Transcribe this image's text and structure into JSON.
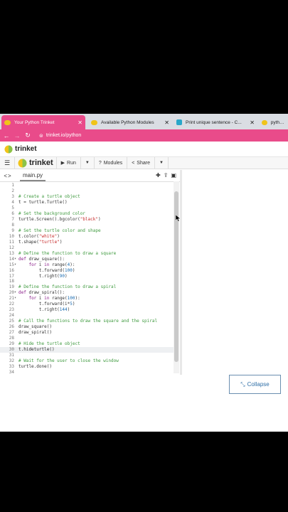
{
  "browser": {
    "tabs": [
      {
        "label": "Your Python Trinket",
        "color": "#f0c419",
        "active": true
      },
      {
        "label": "Available Python Modules",
        "color": "#f0c419",
        "active": false
      },
      {
        "label": "Print unique sentence - C...",
        "color": "#2aa7c9",
        "active": false
      },
      {
        "label": "python -",
        "color": "#f0c419",
        "active": false
      }
    ],
    "close_glyph": "✕",
    "url": "trinket.io/python"
  },
  "header": {
    "name": "trinket"
  },
  "toolbar": {
    "brand": "trinket",
    "run_label": "Run",
    "modules_label": "Modules",
    "share_label": "Share"
  },
  "editor": {
    "file_name": "main.py",
    "active_line": 30,
    "lines": [
      {
        "n": "1",
        "fold": "",
        "html": ""
      },
      {
        "n": "2",
        "fold": "",
        "html": ""
      },
      {
        "n": "3",
        "fold": "",
        "html": "<span class='cm'># Create a turtle object</span>"
      },
      {
        "n": "4",
        "fold": "",
        "html": "t = turtle.Turtle()"
      },
      {
        "n": "5",
        "fold": "",
        "html": ""
      },
      {
        "n": "6",
        "fold": "",
        "html": "<span class='cm'># Set the background color</span>"
      },
      {
        "n": "7",
        "fold": "",
        "html": "turtle.Screen().bgcolor(<span class='st'>\"black\"</span>)"
      },
      {
        "n": "8",
        "fold": "",
        "html": ""
      },
      {
        "n": "9",
        "fold": "",
        "html": "<span class='cm'># Set the turtle color and shape</span>"
      },
      {
        "n": "10",
        "fold": "",
        "html": "t.color(<span class='st'>\"white\"</span>)"
      },
      {
        "n": "11",
        "fold": "",
        "html": "t.shape(<span class='st'>\"turtle\"</span>)"
      },
      {
        "n": "12",
        "fold": "",
        "html": ""
      },
      {
        "n": "13",
        "fold": "",
        "html": "<span class='cm'># Define the function to draw a square</span>"
      },
      {
        "n": "14",
        "fold": "▾",
        "html": "<span class='kw'>def</span> draw_square():"
      },
      {
        "n": "15",
        "fold": "▾",
        "html": "    <span class='kw'>for</span> i <span class='kw'>in</span> range(<span class='nm'>4</span>):"
      },
      {
        "n": "16",
        "fold": "",
        "html": "        t.forward(<span class='nm'>100</span>)"
      },
      {
        "n": "17",
        "fold": "",
        "html": "        t.right(<span class='nm'>90</span>)"
      },
      {
        "n": "18",
        "fold": "",
        "html": ""
      },
      {
        "n": "19",
        "fold": "",
        "html": "<span class='cm'># Define the function to draw a spiral</span>"
      },
      {
        "n": "20",
        "fold": "▾",
        "html": "<span class='kw'>def</span> draw_spiral():"
      },
      {
        "n": "21",
        "fold": "▾",
        "html": "    <span class='kw'>for</span> i <span class='kw'>in</span> range(<span class='nm'>100</span>):"
      },
      {
        "n": "22",
        "fold": "",
        "html": "        t.forward(i*<span class='nm'>5</span>)"
      },
      {
        "n": "23",
        "fold": "",
        "html": "        t.right(<span class='nm'>144</span>)"
      },
      {
        "n": "24",
        "fold": "",
        "html": ""
      },
      {
        "n": "25",
        "fold": "",
        "html": "<span class='cm'># Call the functions to draw the square and the spiral</span>"
      },
      {
        "n": "26",
        "fold": "",
        "html": "draw_square()"
      },
      {
        "n": "27",
        "fold": "",
        "html": "draw_spiral()"
      },
      {
        "n": "28",
        "fold": "",
        "html": ""
      },
      {
        "n": "29",
        "fold": "",
        "html": "<span class='cm'># Hide the turtle object</span>"
      },
      {
        "n": "30",
        "fold": "",
        "html": "t.hideturtle()"
      },
      {
        "n": "31",
        "fold": "",
        "html": ""
      },
      {
        "n": "32",
        "fold": "",
        "html": "<span class='cm'># Wait for the user to close the window</span>"
      },
      {
        "n": "33",
        "fold": "",
        "html": "turtle.done()"
      },
      {
        "n": "34",
        "fold": "",
        "html": ""
      }
    ]
  },
  "output": {
    "collapse_label": "Collapse"
  },
  "colors": {
    "accent": "#e94b8a",
    "link": "#2f6fa7"
  }
}
